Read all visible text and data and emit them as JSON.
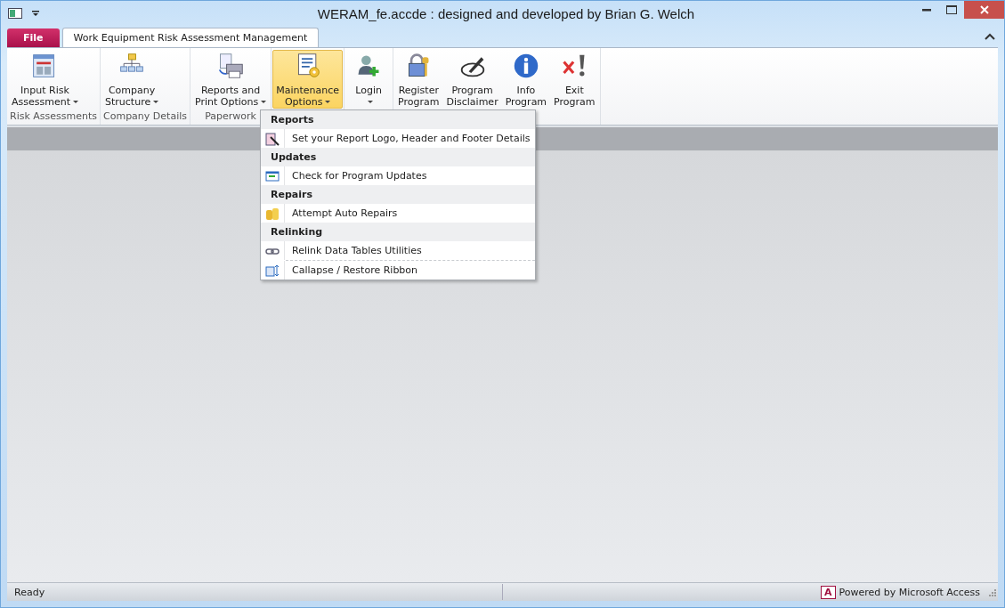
{
  "window": {
    "title": "WERAM_fe.accde : designed and developed by Brian G. Welch"
  },
  "tabs": [
    {
      "label": "File",
      "kind": "file",
      "selected": false
    },
    {
      "label": "Work Equipment Risk Assessment Management",
      "kind": "tab",
      "selected": true
    }
  ],
  "ribbon": {
    "groups": [
      {
        "label": "Risk Assessments",
        "buttons": [
          {
            "label": "Input Risk",
            "label2": "Assessment",
            "dropdown": true,
            "selected": false
          }
        ]
      },
      {
        "label": "Company Details",
        "buttons": [
          {
            "label": "Company",
            "label2": "Structure",
            "dropdown": true,
            "selected": false
          }
        ]
      },
      {
        "label": "Paperwork",
        "buttons": [
          {
            "label": "Reports and",
            "label2": "Print Options",
            "dropdown": true,
            "selected": false
          }
        ]
      },
      {
        "buttons": [
          {
            "label": "Maintenance",
            "label2": "Options",
            "dropdown": true,
            "selected": true
          }
        ]
      },
      {
        "buttons": [
          {
            "label": "Login",
            "dropdown": true,
            "selected": false
          }
        ]
      },
      {
        "buttons": [
          {
            "label": "Register",
            "label2": "Program",
            "dropdown": false,
            "selected": false
          },
          {
            "label": "Program",
            "label2": "Disclaimer",
            "dropdown": false,
            "selected": false
          },
          {
            "label": "Info",
            "label2": "Program",
            "dropdown": false,
            "selected": false
          },
          {
            "label": "Exit",
            "label2": "Program",
            "dropdown": false,
            "selected": false
          }
        ]
      }
    ]
  },
  "menu": {
    "sections": [
      {
        "heading": "Reports",
        "items": [
          {
            "label": "Set your Report Logo, Header and Footer Details"
          }
        ]
      },
      {
        "heading": "Updates",
        "items": [
          {
            "label": "Check for Program Updates"
          }
        ]
      },
      {
        "heading": "Repairs",
        "items": [
          {
            "label": "Attempt Auto Repairs"
          }
        ]
      },
      {
        "heading": "Relinking",
        "items": [
          {
            "label": "Relink Data Tables Utilities"
          },
          {
            "label": "Callapse / Restore Ribbon"
          }
        ]
      }
    ]
  },
  "status_bar": {
    "left": "Ready",
    "right": "Powered by Microsoft Access",
    "logo": "A"
  }
}
